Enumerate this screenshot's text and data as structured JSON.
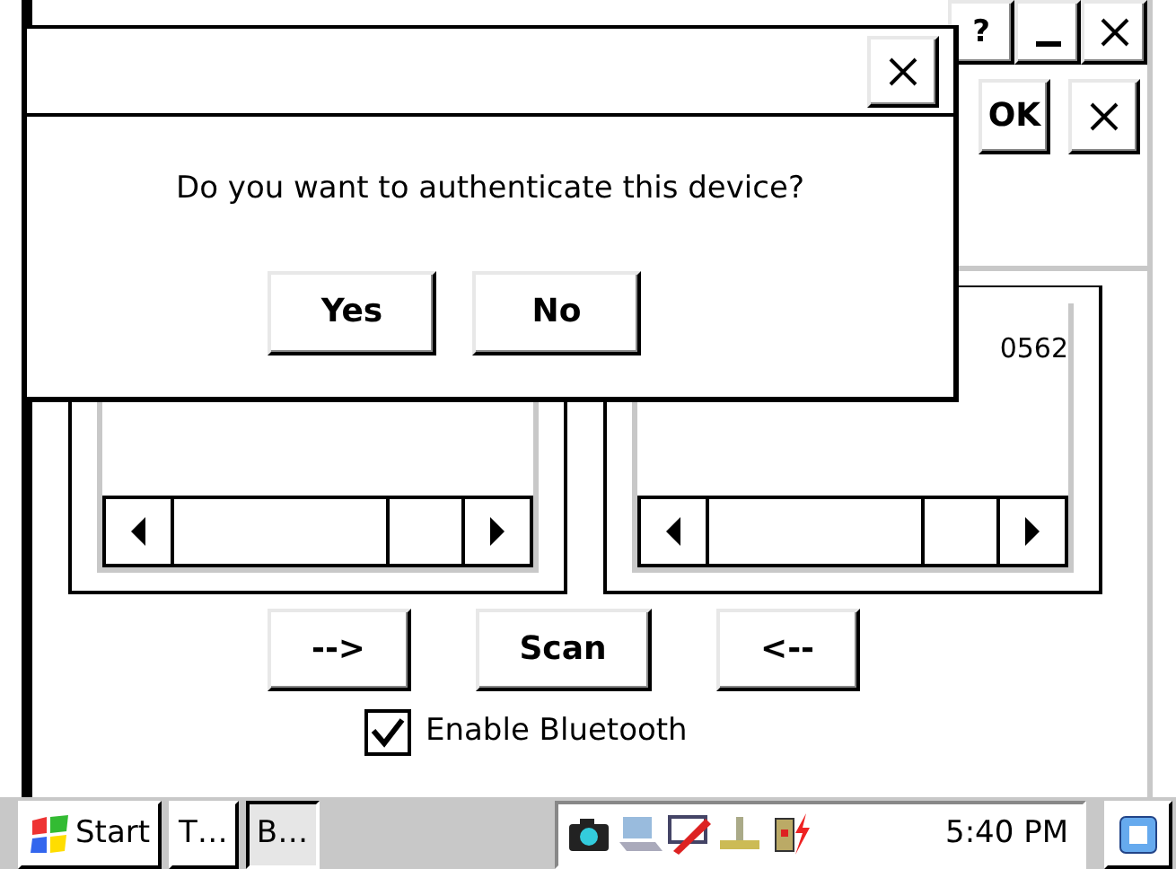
{
  "window": {
    "help": "?"
  },
  "toolbar": {
    "ok": "OK"
  },
  "lists": [
    {
      "kind": "empty"
    },
    {
      "kind": "filled",
      "entry": "0562"
    }
  ],
  "actions": [
    "-->",
    "Scan",
    "<--"
  ],
  "bluetooth": {
    "label": "Enable Bluetooth",
    "checked": true
  },
  "dialog": {
    "message": "Do you want to authenticate this device?",
    "buttons": [
      "Yes",
      "No"
    ]
  },
  "taskbar": {
    "start": "Start",
    "tasks": [
      {
        "label": "T…",
        "selected": false
      },
      {
        "label": "B…",
        "selected": true
      }
    ],
    "clock": "5:40 PM"
  }
}
